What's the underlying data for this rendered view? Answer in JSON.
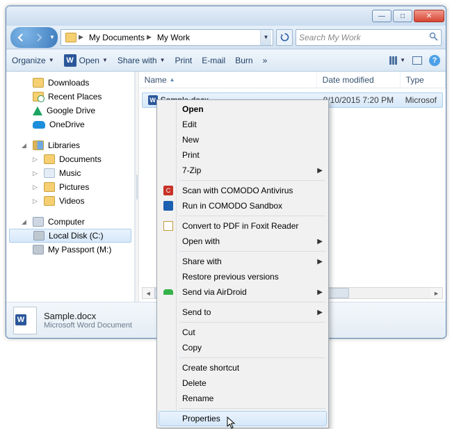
{
  "breadcrumb": {
    "items": [
      "My Documents",
      "My Work"
    ]
  },
  "search": {
    "placeholder": "Search My Work"
  },
  "toolbar": {
    "organize": "Organize",
    "open": "Open",
    "share": "Share with",
    "print": "Print",
    "email": "E-mail",
    "burn": "Burn"
  },
  "sidebar": {
    "downloads": "Downloads",
    "recent": "Recent Places",
    "gdrive": "Google Drive",
    "onedrive": "OneDrive",
    "libraries": "Libraries",
    "documents": "Documents",
    "music": "Music",
    "pictures": "Pictures",
    "videos": "Videos",
    "computer": "Computer",
    "localdisk": "Local Disk (C:)",
    "passport": "My Passport (M:)"
  },
  "columns": {
    "name": "Name",
    "date": "Date modified",
    "type": "Type"
  },
  "file": {
    "name": "Sample.docx",
    "date": "8/10/2015 7:20 PM",
    "type": "Microsof"
  },
  "status": {
    "filename": "Sample.docx",
    "filetype": "Microsoft Word Document"
  },
  "context_menu": {
    "open": "Open",
    "edit": "Edit",
    "new": "New",
    "print": "Print",
    "sevenzip": "7-Zip",
    "scan_comodo": "Scan with COMODO Antivirus",
    "run_sandbox": "Run in COMODO Sandbox",
    "foxit": "Convert to PDF in Foxit Reader",
    "openwith": "Open with",
    "sharewith": "Share with",
    "restore": "Restore previous versions",
    "airdroid": "Send via AirDroid",
    "sendto": "Send to",
    "cut": "Cut",
    "copy": "Copy",
    "shortcut": "Create shortcut",
    "delete": "Delete",
    "rename": "Rename",
    "properties": "Properties"
  }
}
